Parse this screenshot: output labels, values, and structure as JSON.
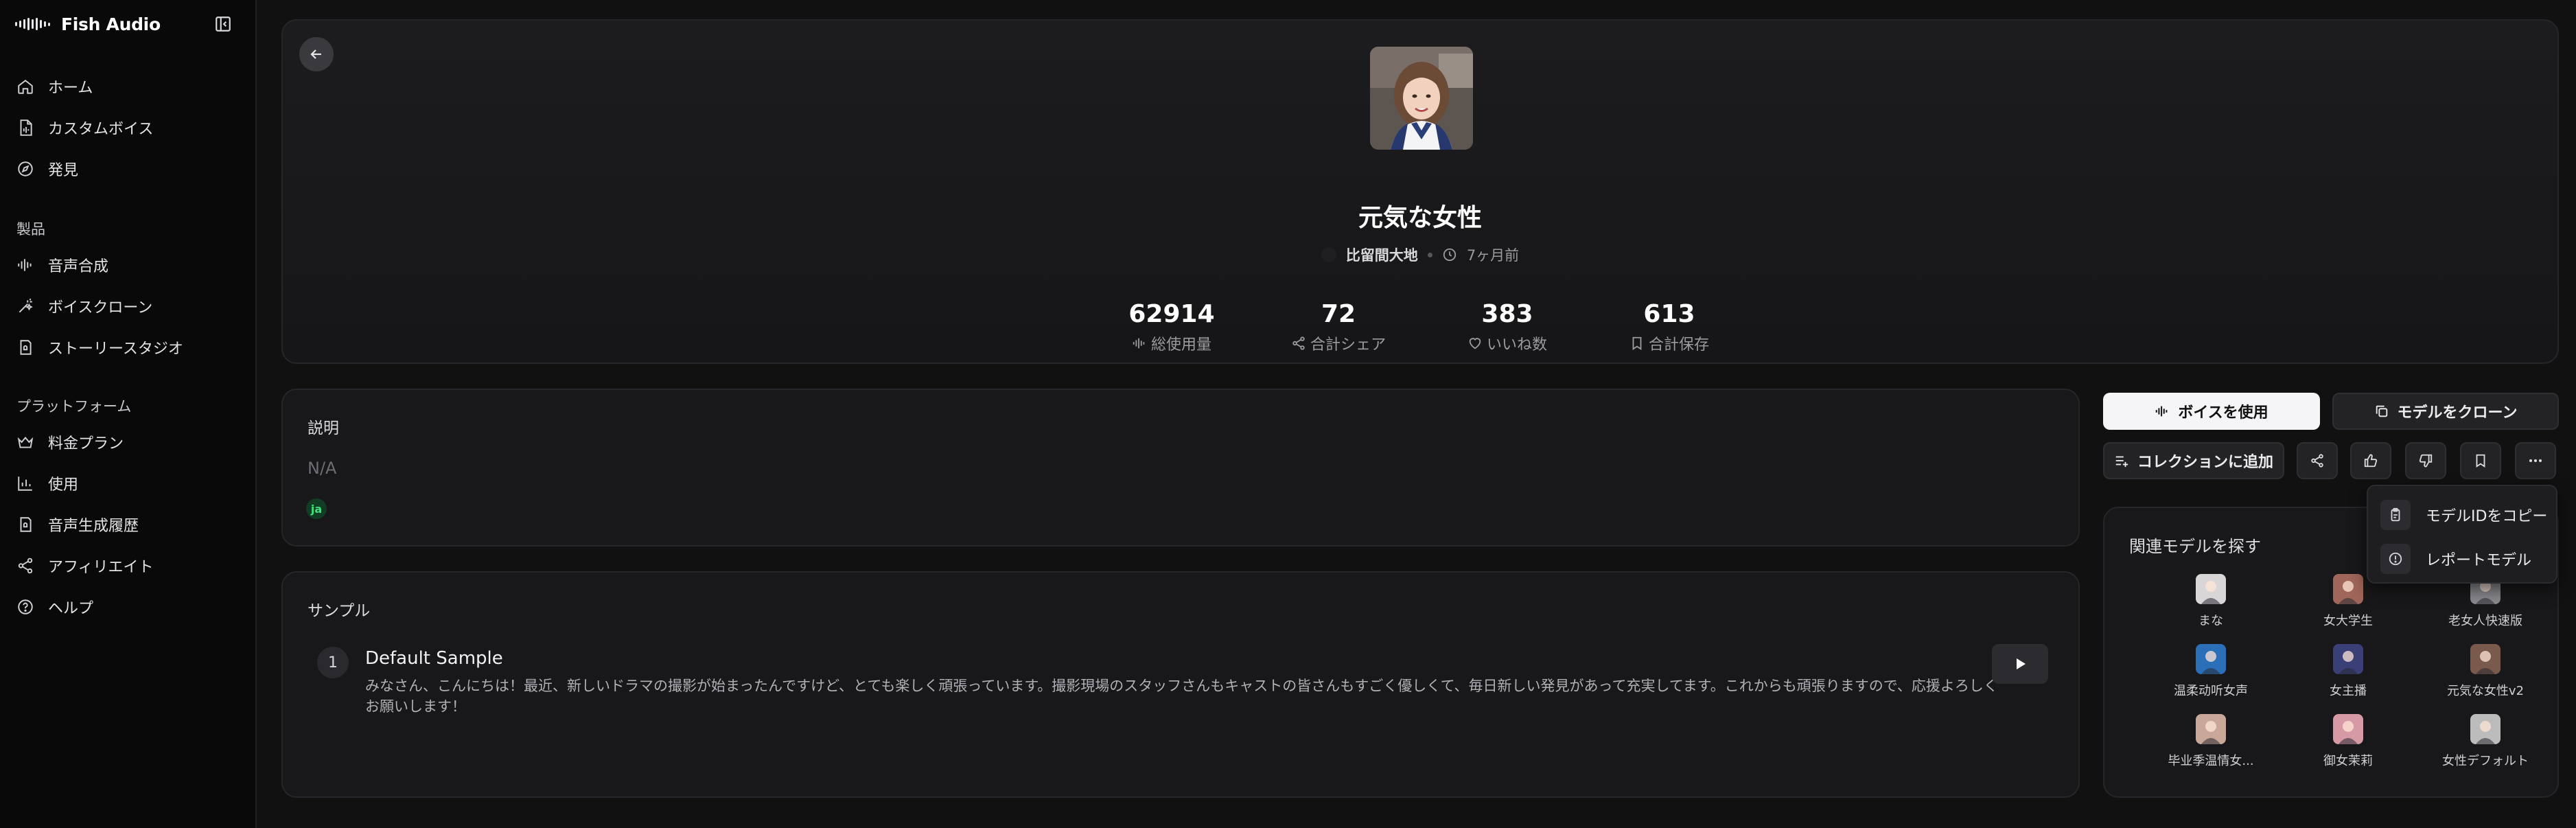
{
  "app": {
    "name": "Fish Audio"
  },
  "sidebar": {
    "primary": [
      {
        "label": "ホーム",
        "icon": "home-icon"
      },
      {
        "label": "カスタムボイス",
        "icon": "file-voice-icon"
      },
      {
        "label": "発見",
        "icon": "compass-icon"
      }
    ],
    "section_products": "製品",
    "products": [
      {
        "label": "音声合成",
        "icon": "waveform-icon"
      },
      {
        "label": "ボイスクローン",
        "icon": "magic-wand-icon"
      },
      {
        "label": "ストーリースタジオ",
        "icon": "book-icon"
      }
    ],
    "section_platform": "プラットフォーム",
    "platform": [
      {
        "label": "料金プラン",
        "icon": "crown-icon"
      },
      {
        "label": "使用",
        "icon": "bar-chart-icon"
      },
      {
        "label": "音声生成履歴",
        "icon": "history-icon"
      },
      {
        "label": "アフィリエイト",
        "icon": "share-icon"
      },
      {
        "label": "ヘルプ",
        "icon": "help-icon"
      }
    ]
  },
  "model": {
    "title": "元気な女性",
    "author": "比留間大地",
    "time": "7ヶ月前",
    "stats": [
      {
        "value": "62914",
        "label": "総使用量",
        "icon": "waveform-icon"
      },
      {
        "value": "72",
        "label": "合計シェア",
        "icon": "share-icon"
      },
      {
        "value": "383",
        "label": "いいね数",
        "icon": "heart-icon"
      },
      {
        "value": "613",
        "label": "合計保存",
        "icon": "bookmark-icon"
      }
    ]
  },
  "description": {
    "title": "説明",
    "text": "N/A",
    "language": "ja"
  },
  "samples": {
    "title": "サンプル",
    "items": [
      {
        "number": "1",
        "title": "Default Sample",
        "text": "みなさん、こんにちは！最近、新しいドラマの撮影が始まったんですけど、とても楽しく頑張っています。撮影現場のスタッフさんもキャストの皆さんもすごく優しくて、毎日新しい発見があって充実してます。これからも頑張りますので、応援よろしくお願いします！"
      }
    ]
  },
  "actions": {
    "use_voice": "ボイスを使用",
    "clone_model": "モデルをクローン",
    "add_to_collection": "コレクションに追加"
  },
  "menu": {
    "copy_id": "モデルIDをコピー",
    "report": "レポートモデル"
  },
  "related": {
    "title": "関連モデルを探す",
    "items": [
      {
        "name": "まな",
        "color": "#d9d6d8"
      },
      {
        "name": "女大学生",
        "color": "#a0665a"
      },
      {
        "name": "老女人快速版",
        "color": "#8a8a8e"
      },
      {
        "name": "温柔动听女声",
        "color": "#2b6fb8"
      },
      {
        "name": "女主播",
        "color": "#3a3f78"
      },
      {
        "name": "元気な女性v2",
        "color": "#7a5a4c"
      },
      {
        "name": "毕业季温情女...",
        "color": "#c9a89a"
      },
      {
        "name": "御女茉莉",
        "color": "#d69aa6"
      },
      {
        "name": "女性デフォルト",
        "color": "#bcbcbc"
      }
    ]
  }
}
